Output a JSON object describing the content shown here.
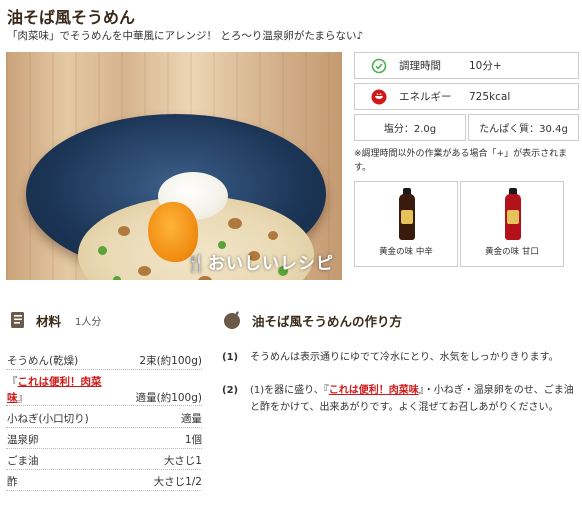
{
  "recipe": {
    "title": "油そば風そうめん",
    "subtitle": "「肉菜味」でそうめんを中華風にアレンジ！ とろ〜り温泉卵がたまらない♪",
    "photo_watermark": "おいしいレシピ"
  },
  "info": {
    "time_label": "調理時間",
    "time_value": "10分+",
    "energy_label": "エネルギー",
    "energy_value": "725kcal",
    "salt": "塩分：2.0g",
    "protein": "たんぱく質：30.4g",
    "note": "※調理時間以外の作業がある場合「+」が表示されます。"
  },
  "products": [
    {
      "name": "黄金の味 中辛",
      "color": "#3a1a0c",
      "label_color": "#e6c35a"
    },
    {
      "name": "黄金の味 甘口",
      "color": "#b3121c",
      "label_color": "#e6c35a"
    }
  ],
  "ingredients": {
    "heading": "材料",
    "servings": "1人分",
    "items": [
      {
        "name": "そうめん(乾燥)",
        "amount": "2束(約100g)"
      },
      {
        "name_pre": "『",
        "name_link_1": "これは便利！肉菜",
        "name_link_2": "味",
        "name_post": "』",
        "amount": "適量(約100g)"
      },
      {
        "name": "小ねぎ(小口切り)",
        "amount": "適量"
      },
      {
        "name": "温泉卵",
        "amount": "1個"
      },
      {
        "name": "ごま油",
        "amount": "大さじ1"
      },
      {
        "name": "酢",
        "amount": "大さじ1/2"
      }
    ]
  },
  "directions": {
    "heading": "油そば風そうめんの作り方",
    "steps": [
      {
        "num": "(1)",
        "text": "そうめんは表示通りにゆでて冷水にとり、水気をしっかりきります。"
      },
      {
        "num": "(2)",
        "text_pre": "(1)を器に盛り、『",
        "link": "これは便利！肉菜味",
        "text_post": "』・小ねぎ・温泉卵をのせ、ごま油と酢をかけて、出来あがりです。よく混ぜてお召しあがりください。"
      }
    ]
  },
  "colors": {
    "accent_green": "#4caf50",
    "link_red": "#d01818",
    "border": "#cccccc"
  }
}
